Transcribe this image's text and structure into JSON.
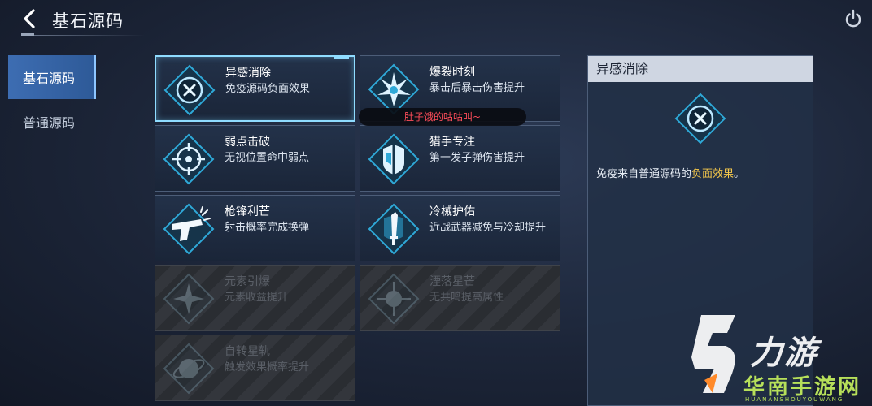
{
  "header": {
    "title": "基石源码",
    "back_icon": "chevron-left-icon",
    "power_icon": "power-icon"
  },
  "sidebar": {
    "items": [
      {
        "label": "基石源码",
        "active": true
      },
      {
        "label": "普通源码",
        "active": false
      }
    ]
  },
  "cards": [
    {
      "name": "异感消除",
      "desc": "免疫源码负面效果",
      "icon": "cross-circle-icon",
      "locked": false,
      "selected": true
    },
    {
      "name": "爆裂时刻",
      "desc": "暴击后暴击伤害提升",
      "icon": "burst-icon",
      "locked": false,
      "selected": false
    },
    {
      "name": "弱点击破",
      "desc": "无视位置命中弱点",
      "icon": "crosshair-icon",
      "locked": false,
      "selected": false
    },
    {
      "name": "猎手专注",
      "desc": "第一发子弹伤害提升",
      "icon": "shield-icon",
      "locked": false,
      "selected": false
    },
    {
      "name": "枪锋利芒",
      "desc": "射击概率完成换弹",
      "icon": "pistol-icon",
      "locked": false,
      "selected": false
    },
    {
      "name": "冷械护佑",
      "desc": "近战武器减免与冷却提升",
      "icon": "blade-icon",
      "locked": false,
      "selected": false
    },
    {
      "name": "元素引爆",
      "desc": "元素收益提升",
      "icon": "element-icon",
      "locked": true,
      "selected": false
    },
    {
      "name": "湮落星芒",
      "desc": "无共鸣提高属性",
      "icon": "star-icon",
      "locked": true,
      "selected": false
    },
    {
      "name": "自转星轨",
      "desc": "触发效果概率提升",
      "icon": "orbit-icon",
      "locked": true,
      "selected": false
    }
  ],
  "tooltip": "肚子饿的咕咕叫~",
  "detail": {
    "title": "异感消除",
    "icon": "cross-circle-icon",
    "desc_prefix": "免疫来自普通源码的",
    "desc_highlight": "负面效果",
    "desc_suffix": "。"
  },
  "colors": {
    "accent": "#8fdcff",
    "active_tab": "#3d6db2",
    "highlight": "#f5c84b",
    "tooltip_text": "#ff4d5a"
  },
  "watermark": {
    "big": "力游",
    "site": "华南手游网",
    "pinyin": "HUANANSHOUYOUWANG"
  }
}
